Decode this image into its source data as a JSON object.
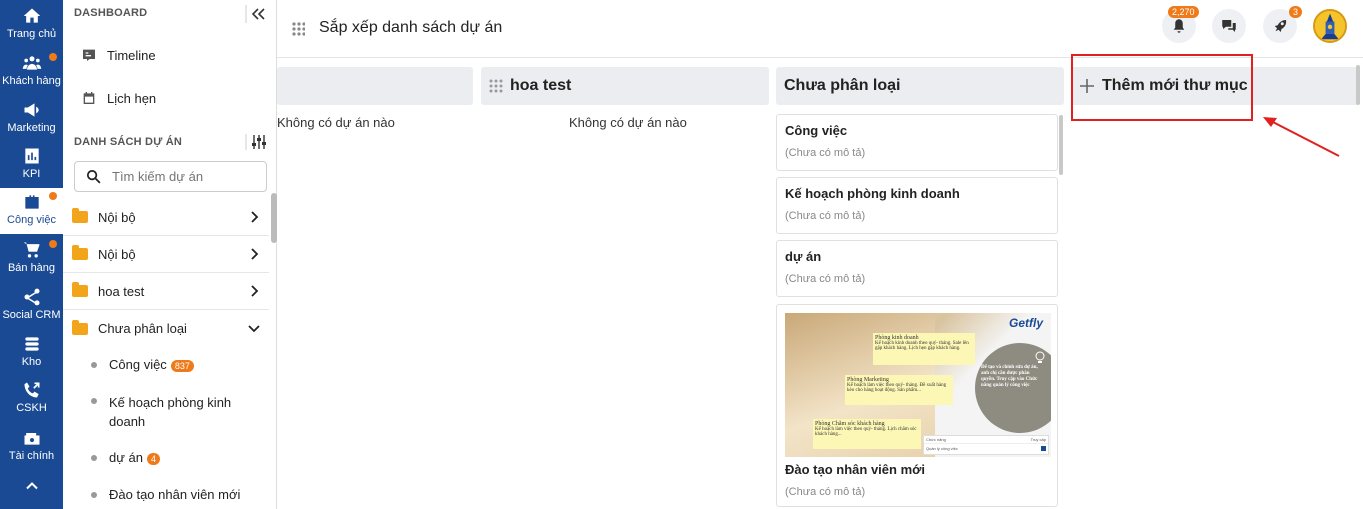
{
  "rail": {
    "items": [
      {
        "label": "Trang chủ",
        "icon": "home-icon"
      },
      {
        "label": "Khách hàng",
        "icon": "users-icon"
      },
      {
        "label": "Marketing",
        "icon": "megaphone-icon"
      },
      {
        "label": "KPI",
        "icon": "chart-icon"
      },
      {
        "label": "Công việc",
        "icon": "briefcase-icon"
      },
      {
        "label": "Bán hàng",
        "icon": "cart-icon"
      },
      {
        "label": "Social CRM",
        "icon": "share-icon"
      },
      {
        "label": "Kho",
        "icon": "warehouse-icon"
      },
      {
        "label": "CSKH",
        "icon": "phone-icon"
      },
      {
        "label": "Tài chính",
        "icon": "money-icon"
      }
    ],
    "colors": {
      "bg": "#1a4a93",
      "dot": "#ef7a1a"
    }
  },
  "sidebar": {
    "dashboard_title": "DASHBOARD",
    "links": {
      "timeline": "Timeline",
      "calendar": "Lịch hẹn"
    },
    "projects_title": "DANH SÁCH DỰ ÁN",
    "search_placeholder": "Tìm kiếm dự án",
    "folders": [
      "Nội bộ",
      "Nội bộ",
      "hoa test",
      "Chưa phân loại"
    ],
    "subitems": [
      {
        "label": "Công việc",
        "badge": "837"
      },
      {
        "label": "Kế hoạch phòng kinh doanh",
        "badge": ""
      },
      {
        "label": "dự án",
        "badge": "4"
      },
      {
        "label": "Đào tạo nhân viên mới",
        "badge": ""
      }
    ]
  },
  "header": {
    "title": "Sắp xếp danh sách dự án",
    "notif_count": "2,270",
    "rocket_count": "3"
  },
  "board": {
    "col1_empty": "Không có dự án nào",
    "col2_title": "hoa test",
    "col2_empty": "Không có dự án nào",
    "col3_title": "Chưa phân loại",
    "add_folder": "Thêm mới thư mục",
    "cards": [
      {
        "title": "Công việc",
        "desc": "(Chưa có mô tả)"
      },
      {
        "title": "Kế hoạch phòng kinh doanh",
        "desc": "(Chưa có mô tả)"
      },
      {
        "title": "dự án",
        "desc": "(Chưa có mô tả)"
      },
      {
        "title": "Đào tạo nhân viên mới",
        "desc": "(Chưa có mô tả)"
      }
    ],
    "image_card": {
      "brand": "Getfly",
      "note1_title": "Phòng kinh doanh",
      "note1_text": "Kế hoạch kinh doanh theo quý- tháng. Sale lên gặp khách hàng. Lịch hẹn gặp khách hàng.",
      "note2_title": "Phòng Marketing",
      "note2_text": "Kế hoạch làm việc theo quý- tháng. Đề xuất hàng kèo cho hàng hoạt động. Sản phẩm...",
      "note3_title": "Phòng Chăm sóc khách hàng",
      "note3_text": "Kế hoạch làm việc theo quý- tháng. Lịch chăm sóc khách hàng...",
      "bubble_text": "Để tạo và chỉnh sửa dự án, anh chị cần được phân quyền. Truy cập vào Chức năng quản lý công việc",
      "table_col1": "Chức năng",
      "table_col2": "Truy cập",
      "table_row": "Quản lý công việc"
    }
  }
}
